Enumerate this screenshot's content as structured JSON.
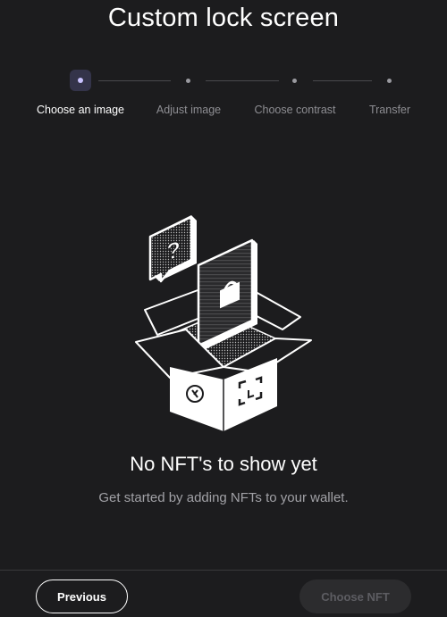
{
  "page": {
    "title": "Custom lock screen"
  },
  "stepper": {
    "steps": [
      {
        "label": "Choose an image",
        "active": true
      },
      {
        "label": "Adjust image",
        "active": false
      },
      {
        "label": "Choose contrast",
        "active": false
      },
      {
        "label": "Transfer",
        "active": false
      }
    ]
  },
  "empty_state": {
    "illustration_icon": "nft-box-illustration",
    "title": "No NFT's to show yet",
    "subtitle": "Get started by adding NFTs to your wallet."
  },
  "footer": {
    "previous_label": "Previous",
    "next_label": "Choose NFT",
    "next_enabled": false
  },
  "colors": {
    "background": "#1c1c1e",
    "accent": "#c9c3ff",
    "text_primary": "#ffffff",
    "text_secondary": "#8e8e93"
  }
}
